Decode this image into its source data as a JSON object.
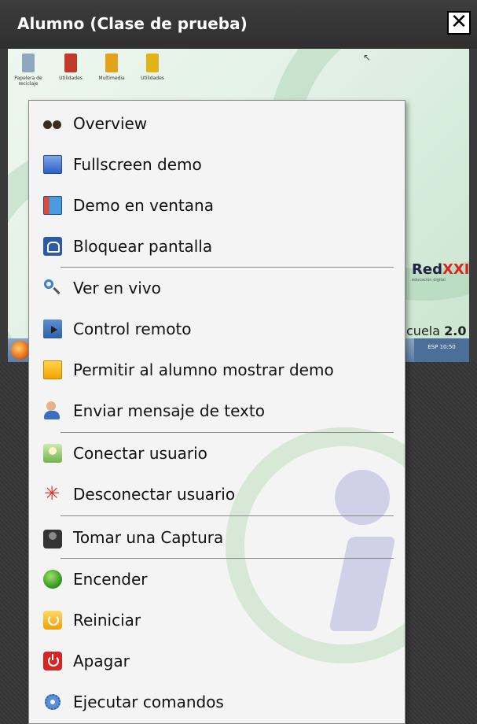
{
  "window": {
    "title": "Alumno (Clase de prueba)",
    "close_glyph": "✕"
  },
  "desktop": {
    "icons": [
      {
        "label": "Papelera de reciclaje",
        "color": "#8fa8c0"
      },
      {
        "label": "Utilidades",
        "color": "#c0392b"
      },
      {
        "label": "Multimedia",
        "color": "#e2a21a"
      },
      {
        "label": "Utilidades",
        "color": "#e2b21a"
      }
    ],
    "logo_main": "Red",
    "logo_accent": "XXI",
    "logo_sub": "educación digital",
    "escuela_prefix": "cuela ",
    "escuela_version": "2.0",
    "tray_text": "ESP 10:50"
  },
  "menu": {
    "items": [
      {
        "label": "Overview",
        "icon": "binoculars-icon"
      },
      {
        "label": "Fullscreen demo",
        "icon": "monitor-icon"
      },
      {
        "label": "Demo en ventana",
        "icon": "window-demo-icon"
      },
      {
        "label": "Bloquear pantalla",
        "icon": "lock-screen-icon"
      },
      {
        "label": "Ver en vivo",
        "icon": "magnifier-icon"
      },
      {
        "label": "Control remoto",
        "icon": "remote-control-icon"
      },
      {
        "label": "Permitir al alumno mostrar demo",
        "icon": "student-demo-icon"
      },
      {
        "label": "Enviar mensaje de texto",
        "icon": "message-user-icon"
      },
      {
        "label": "Conectar usuario",
        "icon": "connect-user-icon"
      },
      {
        "label": "Desconectar usuario",
        "icon": "disconnect-user-icon"
      },
      {
        "label": "Tomar una Captura",
        "icon": "camera-icon"
      },
      {
        "label": "Encender",
        "icon": "power-on-icon"
      },
      {
        "label": "Reiniciar",
        "icon": "restart-icon"
      },
      {
        "label": "Apagar",
        "icon": "shutdown-icon"
      },
      {
        "label": "Ejecutar comandos",
        "icon": "gear-icon"
      }
    ]
  },
  "colors": {
    "titlebar": "#333333",
    "menu_bg": "#f4f4f4",
    "separator": "#8a8a8a"
  }
}
